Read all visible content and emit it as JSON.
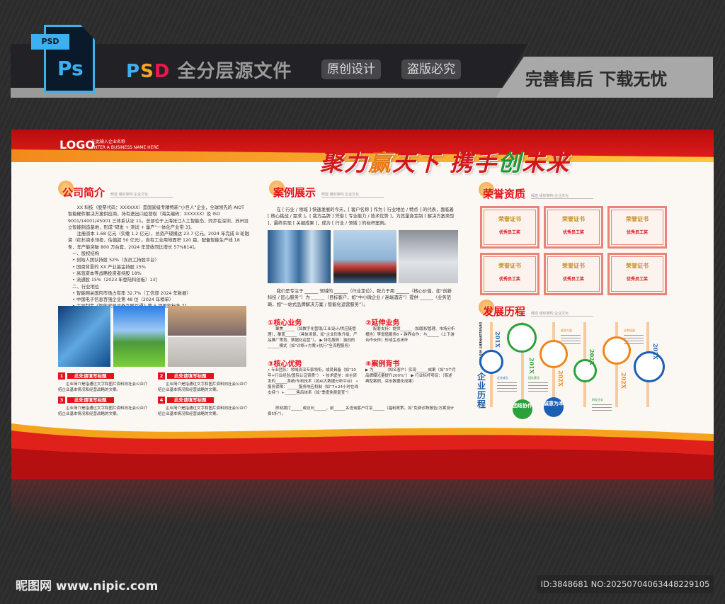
{
  "header": {
    "ps_tag": "PSD",
    "ps_glyph": "Ps",
    "title_p": "P",
    "title_s": "S",
    "title_d": "D",
    "title_rest": " 全分层源文件",
    "pill1": "原创设计",
    "pill2": "盗版必究",
    "slogan": "完善售后 下载无忧"
  },
  "board": {
    "logo": "LOGO",
    "logo_sub1": "在此输入企业名称",
    "logo_sub2": "ENTER A BUSINESS NAME HERE",
    "slogan_a": "聚力",
    "slogan_b": "赢",
    "slogan_c": "天下  携手",
    "slogan_d": "创",
    "slogan_e": "未来",
    "section_sub": "辉煌 组织架构 企业文化",
    "intro": {
      "title": "公司简介",
      "p1": "XX 科技（股票代码：XXXXXX）是国家级专精特新“小巨人”企业，全球领先的 AIOT 智能硬件解决方案供应商，持有进出口经营权（海关编码：XXXXXX）及 ISO 9001/14001/45001 三体系认证 11。总部位于上海张江人工智能岛，同步在深圳、苏州设立智能制造基地，形成“研发 + 测试 + 量产”一体化产业带 3]。",
      "p2": "注册资本 1.68 亿元（实缴 1.2 亿元），总资产规模达 23.7 亿元。2024 年完成 B 轮融资（红杉资本领投，估值超 50 亿元）。自有工业用地面积 120 亩，配备智能生产线 18 条，年产能突破 800 万台套，2024 年营收同比增长 57%814]。",
      "h1": "一、股权结构",
      "list1": [
        "创始人团队持股 52%（含员工持股平台）",
        "国资背景的 XX 产业基金持股 15%",
        "高瓴资本等战略投资者持股 18%",
        "流通股 15%（2023 年登陆科创板）13]"
      ],
      "h2": "二、行业地位",
      "list2": [
        "智能网关国内市场占有率 32.7%（工信部 2024 年数据）",
        "中国电子信息百强企业第 48 位（2024 年榜单）",
        "主导制定《智能家居设备互联互通》等 5 项国家标准 7]"
      ],
      "items": [
        {
          "n": "1",
          "t": "此处请填写标题",
          "d": "企业简介是指通过文字和图片资料向社会公众介绍企业基本情况和经营战略的文案。"
        },
        {
          "n": "2",
          "t": "此处请填写标题",
          "d": "企业简介是指通过文字和图片资料向社会公众介绍企业基本情况和经营战略的文案。"
        },
        {
          "n": "3",
          "t": "此处请填写标题",
          "d": "企业简介是指通过文字和图片资料向社会公众介绍企业基本情况和经营战略的文案。"
        },
        {
          "n": "4",
          "t": "此处请填写标题",
          "d": "企业简介是指通过文字和图片资料向社会公众介绍企业基本情况和经营战略的文案。"
        }
      ]
    },
    "cases": {
      "title": "案例展示",
      "p1": "在 [ 行业 / 领域 ] 快速发展的今天，[ 客户名称 ] 作为 [ 行业地位 / 特点 ] 的代表，面临着 [ 核心挑战 / 需求 ]。[ 我方品牌 ] 凭借 [ 专业能力 / 技术优势 ]，为其量身定制 [ 解决方案类型 ]，最终实现 [ 关键成果 ]，成为 [ 行业 / 领域 ] 的标杆案例。",
      "p2": "我们是专注于 ______ 领域的 ______（行业定位），致力于用 ______（核心价值，如“创新科技 / 匠心服务”）为 ______（目标客户，如“中小微企业 / 高端酒店”）提供 ______（业务范畴，如“一站式品牌解决方案 / 智能化运营服务”）。",
      "b1": {
        "t": "①核心业务",
        "d": "聚焦______（如数字化营销/工业设计/供应链管理），覆盖______（具体场景，如“企业形象升级、产品推广策划、数据化运营”）。 ▶ 特色服务：独创的______模式（如“诊断+方案+执行”全流程服务）"
      },
      "b2": {
        "t": "②延伸业务",
        "d": "配套支持：提供______（如版权管理、市场分析报告）等增值服务6 • 跨界合作：与______（上下游合作伙伴）形成生态闭环"
      },
      "b3": {
        "t": "③核心优势",
        "d": "• 专业团队：领域资深专家领衔，成员具备（如“10年+行业经验/国际认证资质”） • 技术壁垒：自主研发的______系统/专利技术（如AI大数据分析平台） • 服务保障：______服务响应机制（如“7×24小时在线支持”）+______售后体系（如“季度免费复查”）"
      },
      "b4": {
        "t": "④案例背书",
        "d": "▶ 为______（知名客户）实现______成果（如“3个月品牌曝光量提升200%”） ▶ 行业标杆项目：（简述典型案例，突出数据化成果）"
      },
      "p3": "即刻拨打______或访问______，前______名咨询客户可享______（福利政策，如“免费诊断报告/方案设计费5折”）。"
    },
    "honors": {
      "title": "荣誉资质",
      "cert_title": "荣誉证书",
      "cert_award": "优秀员工奖",
      "count": 6
    },
    "history": {
      "title": "发展历程",
      "en": "DEVELOPMENT HISTORY",
      "cn": "企业历程",
      "years": [
        "201X",
        "201X",
        "202X",
        "202X",
        "202X",
        "202X"
      ],
      "labels": [
        "企业成立",
        "团队建设",
        "展览方面",
        "研发业务",
        "业务拓展"
      ],
      "badges": [
        "团结协作",
        "诚意为本"
      ]
    }
  },
  "footer": {
    "site": "昵图网 www.nipic.com",
    "id": "ID:3848681 NO:20250704063448229105"
  }
}
